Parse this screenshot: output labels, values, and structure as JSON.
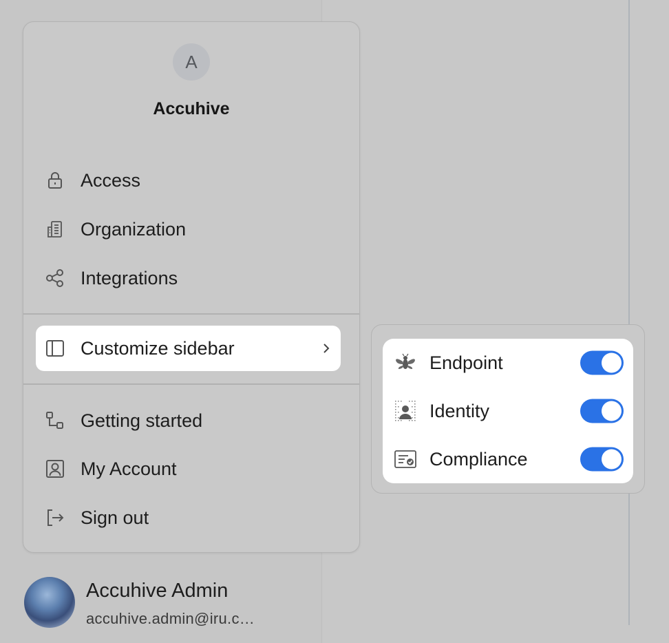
{
  "org": {
    "avatar_letter": "A",
    "name": "Accuhive"
  },
  "menu": {
    "items_top": [
      {
        "label": "Access",
        "icon": "lock-icon"
      },
      {
        "label": "Organization",
        "icon": "building-icon"
      },
      {
        "label": "Integrations",
        "icon": "share-nodes-icon"
      }
    ],
    "customize": {
      "label": "Customize sidebar",
      "icon": "sidebar-panel-icon"
    },
    "items_bottom": [
      {
        "label": "Getting started",
        "icon": "flow-steps-icon"
      },
      {
        "label": "My Account",
        "icon": "user-square-icon"
      },
      {
        "label": "Sign out",
        "icon": "sign-out-icon"
      }
    ]
  },
  "submenu": {
    "toggles": [
      {
        "label": "Endpoint",
        "icon": "bee-icon",
        "enabled": true
      },
      {
        "label": "Identity",
        "icon": "identity-person-icon",
        "enabled": true
      },
      {
        "label": "Compliance",
        "icon": "certificate-icon",
        "enabled": true
      }
    ]
  },
  "user": {
    "name": "Accuhive Admin",
    "email": "accuhive.admin@iru.c…"
  },
  "colors": {
    "toggle_on": "#2a72e6",
    "background": "#c8c8c8",
    "menu_surface": "#c9c9c9"
  }
}
